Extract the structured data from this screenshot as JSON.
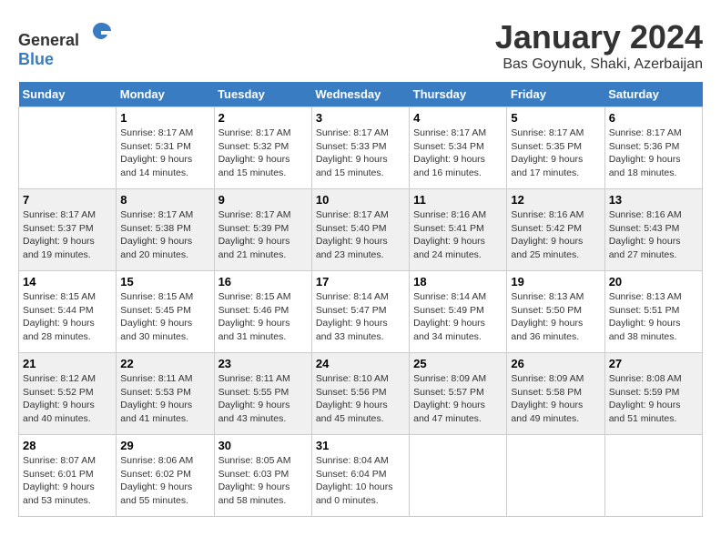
{
  "logo": {
    "general": "General",
    "blue": "Blue"
  },
  "title": "January 2024",
  "location": "Bas Goynuk, Shaki, Azerbaijan",
  "weekdays": [
    "Sunday",
    "Monday",
    "Tuesday",
    "Wednesday",
    "Thursday",
    "Friday",
    "Saturday"
  ],
  "weeks": [
    [
      {
        "day": "",
        "sunrise": "",
        "sunset": "",
        "daylight": ""
      },
      {
        "day": "1",
        "sunrise": "Sunrise: 8:17 AM",
        "sunset": "Sunset: 5:31 PM",
        "daylight": "Daylight: 9 hours and 14 minutes."
      },
      {
        "day": "2",
        "sunrise": "Sunrise: 8:17 AM",
        "sunset": "Sunset: 5:32 PM",
        "daylight": "Daylight: 9 hours and 15 minutes."
      },
      {
        "day": "3",
        "sunrise": "Sunrise: 8:17 AM",
        "sunset": "Sunset: 5:33 PM",
        "daylight": "Daylight: 9 hours and 15 minutes."
      },
      {
        "day": "4",
        "sunrise": "Sunrise: 8:17 AM",
        "sunset": "Sunset: 5:34 PM",
        "daylight": "Daylight: 9 hours and 16 minutes."
      },
      {
        "day": "5",
        "sunrise": "Sunrise: 8:17 AM",
        "sunset": "Sunset: 5:35 PM",
        "daylight": "Daylight: 9 hours and 17 minutes."
      },
      {
        "day": "6",
        "sunrise": "Sunrise: 8:17 AM",
        "sunset": "Sunset: 5:36 PM",
        "daylight": "Daylight: 9 hours and 18 minutes."
      }
    ],
    [
      {
        "day": "7",
        "sunrise": "Sunrise: 8:17 AM",
        "sunset": "Sunset: 5:37 PM",
        "daylight": "Daylight: 9 hours and 19 minutes."
      },
      {
        "day": "8",
        "sunrise": "Sunrise: 8:17 AM",
        "sunset": "Sunset: 5:38 PM",
        "daylight": "Daylight: 9 hours and 20 minutes."
      },
      {
        "day": "9",
        "sunrise": "Sunrise: 8:17 AM",
        "sunset": "Sunset: 5:39 PM",
        "daylight": "Daylight: 9 hours and 21 minutes."
      },
      {
        "day": "10",
        "sunrise": "Sunrise: 8:17 AM",
        "sunset": "Sunset: 5:40 PM",
        "daylight": "Daylight: 9 hours and 23 minutes."
      },
      {
        "day": "11",
        "sunrise": "Sunrise: 8:16 AM",
        "sunset": "Sunset: 5:41 PM",
        "daylight": "Daylight: 9 hours and 24 minutes."
      },
      {
        "day": "12",
        "sunrise": "Sunrise: 8:16 AM",
        "sunset": "Sunset: 5:42 PM",
        "daylight": "Daylight: 9 hours and 25 minutes."
      },
      {
        "day": "13",
        "sunrise": "Sunrise: 8:16 AM",
        "sunset": "Sunset: 5:43 PM",
        "daylight": "Daylight: 9 hours and 27 minutes."
      }
    ],
    [
      {
        "day": "14",
        "sunrise": "Sunrise: 8:15 AM",
        "sunset": "Sunset: 5:44 PM",
        "daylight": "Daylight: 9 hours and 28 minutes."
      },
      {
        "day": "15",
        "sunrise": "Sunrise: 8:15 AM",
        "sunset": "Sunset: 5:45 PM",
        "daylight": "Daylight: 9 hours and 30 minutes."
      },
      {
        "day": "16",
        "sunrise": "Sunrise: 8:15 AM",
        "sunset": "Sunset: 5:46 PM",
        "daylight": "Daylight: 9 hours and 31 minutes."
      },
      {
        "day": "17",
        "sunrise": "Sunrise: 8:14 AM",
        "sunset": "Sunset: 5:47 PM",
        "daylight": "Daylight: 9 hours and 33 minutes."
      },
      {
        "day": "18",
        "sunrise": "Sunrise: 8:14 AM",
        "sunset": "Sunset: 5:49 PM",
        "daylight": "Daylight: 9 hours and 34 minutes."
      },
      {
        "day": "19",
        "sunrise": "Sunrise: 8:13 AM",
        "sunset": "Sunset: 5:50 PM",
        "daylight": "Daylight: 9 hours and 36 minutes."
      },
      {
        "day": "20",
        "sunrise": "Sunrise: 8:13 AM",
        "sunset": "Sunset: 5:51 PM",
        "daylight": "Daylight: 9 hours and 38 minutes."
      }
    ],
    [
      {
        "day": "21",
        "sunrise": "Sunrise: 8:12 AM",
        "sunset": "Sunset: 5:52 PM",
        "daylight": "Daylight: 9 hours and 40 minutes."
      },
      {
        "day": "22",
        "sunrise": "Sunrise: 8:11 AM",
        "sunset": "Sunset: 5:53 PM",
        "daylight": "Daylight: 9 hours and 41 minutes."
      },
      {
        "day": "23",
        "sunrise": "Sunrise: 8:11 AM",
        "sunset": "Sunset: 5:55 PM",
        "daylight": "Daylight: 9 hours and 43 minutes."
      },
      {
        "day": "24",
        "sunrise": "Sunrise: 8:10 AM",
        "sunset": "Sunset: 5:56 PM",
        "daylight": "Daylight: 9 hours and 45 minutes."
      },
      {
        "day": "25",
        "sunrise": "Sunrise: 8:09 AM",
        "sunset": "Sunset: 5:57 PM",
        "daylight": "Daylight: 9 hours and 47 minutes."
      },
      {
        "day": "26",
        "sunrise": "Sunrise: 8:09 AM",
        "sunset": "Sunset: 5:58 PM",
        "daylight": "Daylight: 9 hours and 49 minutes."
      },
      {
        "day": "27",
        "sunrise": "Sunrise: 8:08 AM",
        "sunset": "Sunset: 5:59 PM",
        "daylight": "Daylight: 9 hours and 51 minutes."
      }
    ],
    [
      {
        "day": "28",
        "sunrise": "Sunrise: 8:07 AM",
        "sunset": "Sunset: 6:01 PM",
        "daylight": "Daylight: 9 hours and 53 minutes."
      },
      {
        "day": "29",
        "sunrise": "Sunrise: 8:06 AM",
        "sunset": "Sunset: 6:02 PM",
        "daylight": "Daylight: 9 hours and 55 minutes."
      },
      {
        "day": "30",
        "sunrise": "Sunrise: 8:05 AM",
        "sunset": "Sunset: 6:03 PM",
        "daylight": "Daylight: 9 hours and 58 minutes."
      },
      {
        "day": "31",
        "sunrise": "Sunrise: 8:04 AM",
        "sunset": "Sunset: 6:04 PM",
        "daylight": "Daylight: 10 hours and 0 minutes."
      },
      {
        "day": "",
        "sunrise": "",
        "sunset": "",
        "daylight": ""
      },
      {
        "day": "",
        "sunrise": "",
        "sunset": "",
        "daylight": ""
      },
      {
        "day": "",
        "sunrise": "",
        "sunset": "",
        "daylight": ""
      }
    ]
  ]
}
